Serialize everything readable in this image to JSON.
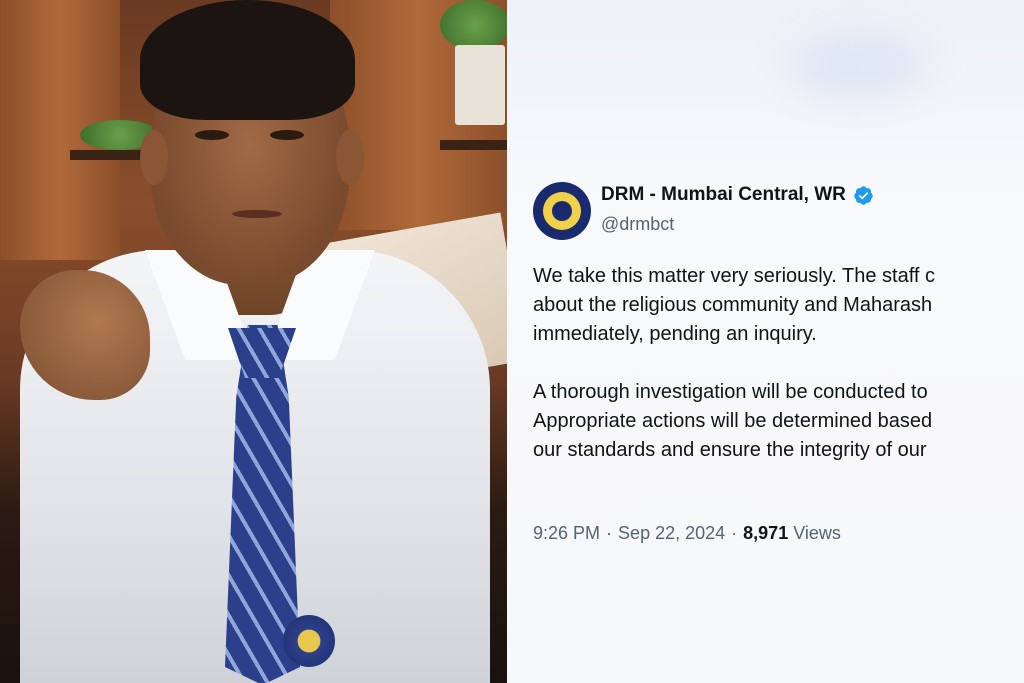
{
  "tweet": {
    "display_name": "DRM - Mumbai Central, WR",
    "handle": "@drmbct",
    "verified": true,
    "lines": [
      "We take this matter very seriously. The staff c",
      "about the religious community and Maharash",
      "immediately, pending an inquiry.",
      "",
      "A thorough investigation will be conducted to",
      "Appropriate actions will be determined based",
      "our standards and ensure the integrity of our"
    ],
    "time": "9:26 PM",
    "separator": "·",
    "date": "Sep 22, 2024",
    "views_count": "8,971",
    "views_label": "Views"
  },
  "colors": {
    "verified_badge": "#1d9bf0",
    "text_primary": "#0f1419",
    "text_secondary": "#536471"
  }
}
